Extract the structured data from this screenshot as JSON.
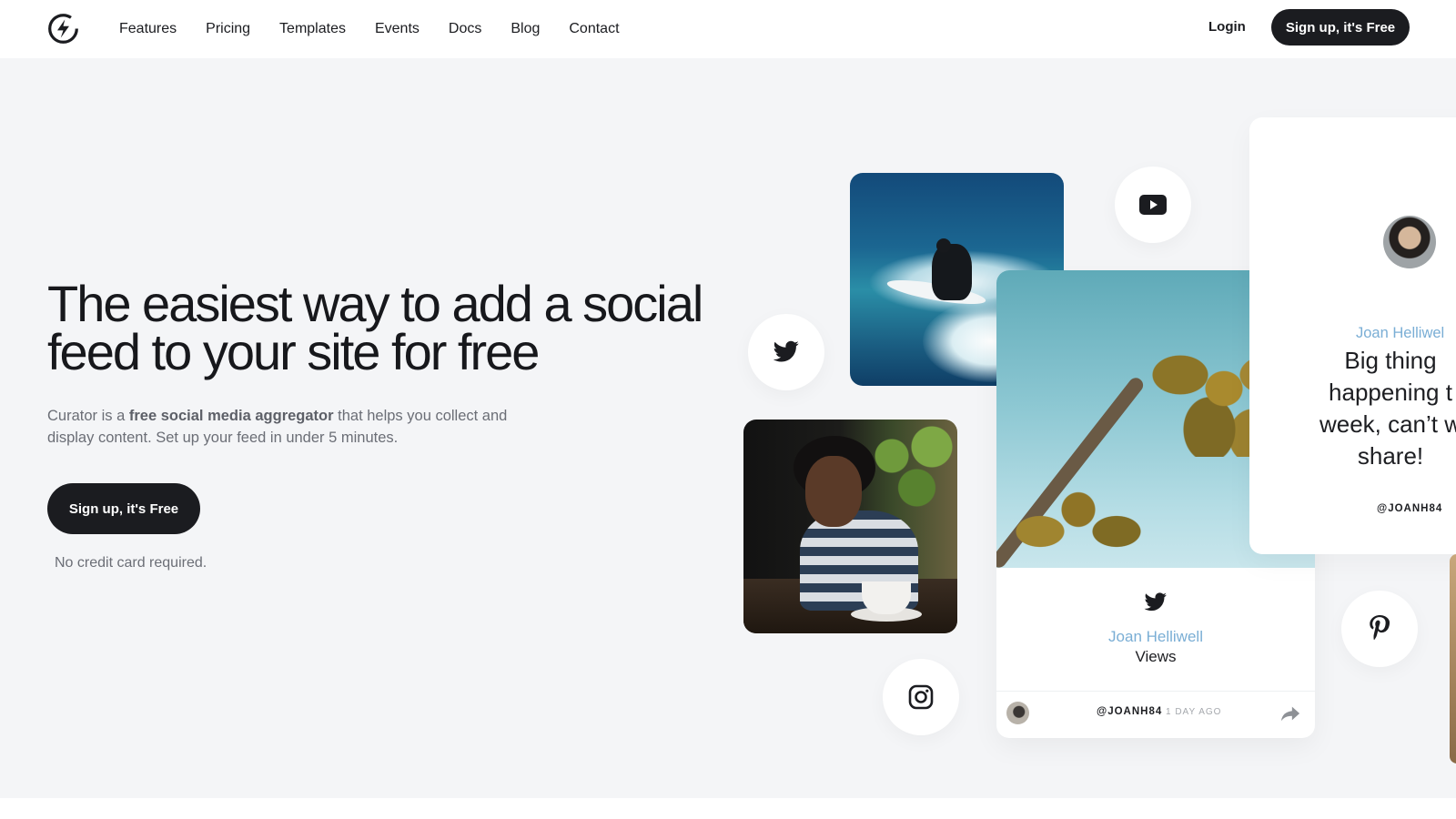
{
  "header": {
    "nav": [
      "Features",
      "Pricing",
      "Templates",
      "Events",
      "Docs",
      "Blog",
      "Contact"
    ],
    "login_label": "Login",
    "cta_label": "Sign up, it's Free"
  },
  "hero": {
    "headline": "The easiest way to add a social feed to your site for free",
    "subtext_prefix": "Curator is a ",
    "subtext_bold": "free social media aggregator",
    "subtext_suffix": " that helps you collect and display content. Set up your feed in under 5 minutes.",
    "cta_label": "Sign up, it's Free",
    "note": "No credit card required."
  },
  "palm_card": {
    "name": "Joan Helliwell",
    "text": "Views",
    "handle": "@JOANH84",
    "ago": "1 DAY AGO"
  },
  "text_card": {
    "name": "Joan Helliwel",
    "quote": "Big thing\nhappening t\nweek, can’t w\nshare!",
    "handle": "@JOANH84"
  },
  "colors": {
    "accent_blue": "#7aaed5",
    "dark": "#1b1c20",
    "hero_bg": "#f4f5f7"
  },
  "icons": [
    "logo-icon",
    "youtube-icon",
    "twitter-icon",
    "instagram-icon",
    "pinterest-icon",
    "share-icon"
  ]
}
